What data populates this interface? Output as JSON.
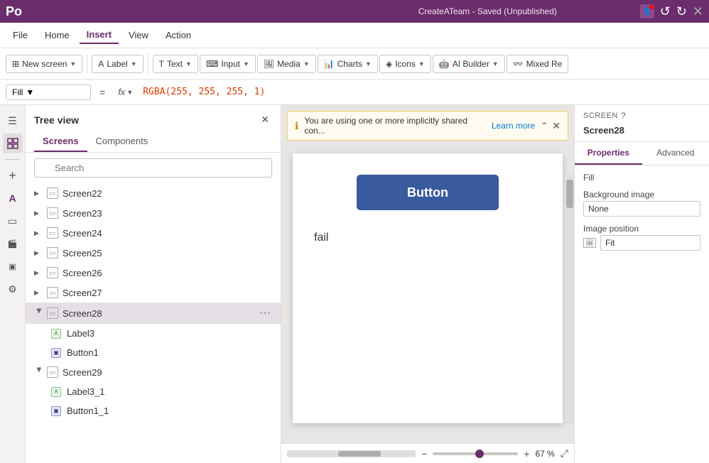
{
  "app": {
    "title": "CreateATeam - Saved (Unpublished)"
  },
  "menu": {
    "items": [
      "File",
      "Home",
      "Insert",
      "View",
      "Action"
    ],
    "active": "Insert"
  },
  "toolbar": {
    "new_screen": "New screen",
    "label": "Label",
    "text": "Text",
    "input": "Input",
    "media": "Media",
    "charts": "Charts",
    "icons": "Icons",
    "ai_builder": "AI Builder",
    "mixed_re": "Mixed Re"
  },
  "formula_bar": {
    "fill_label": "Fill",
    "equals": "=",
    "fx": "fx",
    "formula": "RGBA(255, 255, 255, 1)"
  },
  "tree_view": {
    "title": "Tree view",
    "tabs": [
      "Screens",
      "Components"
    ],
    "active_tab": "Screens",
    "search_placeholder": "Search",
    "screens": [
      {
        "id": "Screen22",
        "label": "Screen22",
        "expanded": false,
        "selected": false,
        "children": []
      },
      {
        "id": "Screen23",
        "label": "Screen23",
        "expanded": false,
        "selected": false,
        "children": []
      },
      {
        "id": "Screen24",
        "label": "Screen24",
        "expanded": false,
        "selected": false,
        "children": []
      },
      {
        "id": "Screen25",
        "label": "Screen25",
        "expanded": false,
        "selected": false,
        "children": []
      },
      {
        "id": "Screen26",
        "label": "Screen26",
        "expanded": false,
        "selected": false,
        "children": []
      },
      {
        "id": "Screen27",
        "label": "Screen27",
        "expanded": false,
        "selected": false,
        "children": []
      },
      {
        "id": "Screen28",
        "label": "Screen28",
        "expanded": true,
        "selected": true,
        "children": [
          {
            "id": "Label3",
            "label": "Label3",
            "type": "label"
          },
          {
            "id": "Button1",
            "label": "Button1",
            "type": "button"
          }
        ]
      },
      {
        "id": "Screen29",
        "label": "Screen29",
        "expanded": true,
        "selected": false,
        "children": [
          {
            "id": "Label3_1",
            "label": "Label3_1",
            "type": "label"
          },
          {
            "id": "Button1_1",
            "label": "Button1_1",
            "type": "button"
          }
        ]
      }
    ]
  },
  "notification": {
    "message": "You are using one or more implicitly shared con...",
    "link_text": "Learn more"
  },
  "canvas": {
    "button_text": "Button",
    "label_text": "fail",
    "zoom_percent": "67 %"
  },
  "right_panel": {
    "screen_section": "SCREEN",
    "screen_name": "Screen28",
    "tabs": [
      "Properties",
      "Advanced"
    ],
    "active_tab": "Properties",
    "fill_label": "Fill",
    "background_image_label": "Background image",
    "background_image_value": "None",
    "image_position_label": "Image position",
    "image_position_value": "Fit"
  },
  "left_icons": {
    "icons": [
      "☰",
      "⬛",
      "+",
      "A",
      "▭",
      "🎬",
      "▣",
      "⚙"
    ]
  }
}
